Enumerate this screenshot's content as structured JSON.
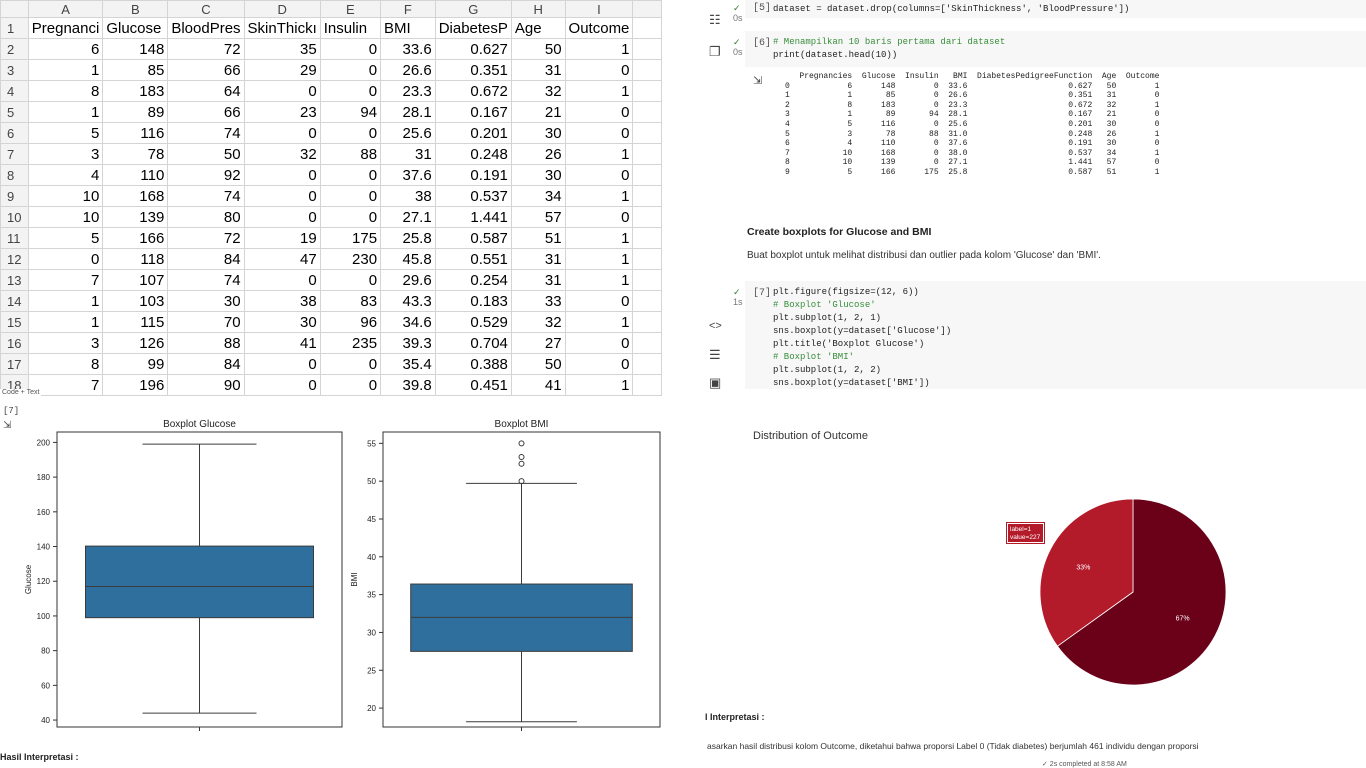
{
  "spreadsheet": {
    "col_letters": [
      "A",
      "B",
      "C",
      "D",
      "E",
      "F",
      "G",
      "H",
      "I"
    ],
    "col_headers": [
      "Pregnanci",
      "Glucose",
      "BloodPres",
      "SkinThickı",
      "Insulin",
      "BMI",
      "DiabetesP",
      "Age",
      "Outcome"
    ],
    "rows": [
      {
        "n": "2",
        "v": [
          "6",
          "148",
          "72",
          "35",
          "0",
          "33.6",
          "0.627",
          "50",
          "1"
        ]
      },
      {
        "n": "3",
        "v": [
          "1",
          "85",
          "66",
          "29",
          "0",
          "26.6",
          "0.351",
          "31",
          "0"
        ]
      },
      {
        "n": "4",
        "v": [
          "8",
          "183",
          "64",
          "0",
          "0",
          "23.3",
          "0.672",
          "32",
          "1"
        ]
      },
      {
        "n": "5",
        "v": [
          "1",
          "89",
          "66",
          "23",
          "94",
          "28.1",
          "0.167",
          "21",
          "0"
        ]
      },
      {
        "n": "6",
        "v": [
          "5",
          "116",
          "74",
          "0",
          "0",
          "25.6",
          "0.201",
          "30",
          "0"
        ]
      },
      {
        "n": "7",
        "v": [
          "3",
          "78",
          "50",
          "32",
          "88",
          "31",
          "0.248",
          "26",
          "1"
        ]
      },
      {
        "n": "8",
        "v": [
          "4",
          "110",
          "92",
          "0",
          "0",
          "37.6",
          "0.191",
          "30",
          "0"
        ]
      },
      {
        "n": "9",
        "v": [
          "10",
          "168",
          "74",
          "0",
          "0",
          "38",
          "0.537",
          "34",
          "1"
        ]
      },
      {
        "n": "10",
        "v": [
          "10",
          "139",
          "80",
          "0",
          "0",
          "27.1",
          "1.441",
          "57",
          "0"
        ]
      },
      {
        "n": "11",
        "v": [
          "5",
          "166",
          "72",
          "19",
          "175",
          "25.8",
          "0.587",
          "51",
          "1"
        ]
      },
      {
        "n": "12",
        "v": [
          "0",
          "118",
          "84",
          "47",
          "230",
          "45.8",
          "0.551",
          "31",
          "1"
        ]
      },
      {
        "n": "13",
        "v": [
          "7",
          "107",
          "74",
          "0",
          "0",
          "29.6",
          "0.254",
          "31",
          "1"
        ]
      },
      {
        "n": "14",
        "v": [
          "1",
          "103",
          "30",
          "38",
          "83",
          "43.3",
          "0.183",
          "33",
          "0"
        ]
      },
      {
        "n": "15",
        "v": [
          "1",
          "115",
          "70",
          "30",
          "96",
          "34.6",
          "0.529",
          "32",
          "1"
        ]
      },
      {
        "n": "16",
        "v": [
          "3",
          "126",
          "88",
          "41",
          "235",
          "39.3",
          "0.704",
          "27",
          "0"
        ]
      },
      {
        "n": "17",
        "v": [
          "8",
          "99",
          "84",
          "0",
          "0",
          "35.4",
          "0.388",
          "50",
          "0"
        ]
      },
      {
        "n": "18",
        "v": [
          "7",
          "196",
          "90",
          "0",
          "0",
          "39.8",
          "0.451",
          "41",
          "1"
        ]
      }
    ],
    "overlay_text": "Code  + Text"
  },
  "notebook": {
    "cell5": {
      "num": "[5]",
      "time": "0s",
      "code": "dataset = dataset.drop(columns=['SkinThickness', 'BloodPressure'])"
    },
    "cell6": {
      "num": "[6]",
      "time": "0s",
      "comment": "# Menampilkan 10 baris pertama dari dataset",
      "code2": "print(dataset.head(10))"
    },
    "output6": "   Pregnancies  Glucose  Insulin   BMI  DiabetesPedigreeFunction  Age  Outcome\n0            6      148        0  33.6                     0.627   50        1\n1            1       85        0  26.6                     0.351   31        0\n2            8      183        0  23.3                     0.672   32        1\n3            1       89       94  28.1                     0.167   21        0\n4            5      116        0  25.6                     0.201   30        0\n5            3       78       88  31.0                     0.248   26        1\n6            4      110        0  37.6                     0.191   30        0\n7           10      168        0  38.0                     0.537   34        1\n8           10      139        0  27.1                     1.441   57        0\n9            5      166      175  25.8                     0.587   51        1",
    "md_title": "Create boxplots for Glucose and BMI",
    "md_text": "Buat boxplot untuk melihat distribusi dan outlier pada kolom 'Glucose' dan 'BMI'.",
    "cell7": {
      "num": "[7]",
      "time": "1s",
      "lines": [
        "plt.figure(figsize=(12, 6))",
        "# Boxplot 'Glucose'",
        "plt.subplot(1, 2, 1)",
        "sns.boxplot(y=dataset['Glucose'])",
        "plt.title('Boxplot Glucose')",
        "# Boxplot 'BMI'",
        "plt.subplot(1, 2, 2)",
        "sns.boxplot(y=dataset['BMI'])"
      ]
    },
    "side_icons": [
      "code-icon",
      "list-icon",
      "terminal-icon"
    ]
  },
  "boxplot_panel": {
    "cell_num": "[7]",
    "footer": "Hasil Interpretasi :"
  },
  "chart_data": [
    {
      "type": "boxplot",
      "title": "Boxplot Glucose",
      "ylabel": "Glucose",
      "ylim": [
        36,
        206
      ],
      "yticks": [
        40,
        60,
        80,
        100,
        120,
        140,
        160,
        180,
        200
      ],
      "whisker_low": 44,
      "q1": 99,
      "median": 117,
      "q3": 140.25,
      "whisker_high": 199,
      "outliers": [],
      "color": "#2e6f9e"
    },
    {
      "type": "boxplot",
      "title": "Boxplot BMI",
      "ylabel": "BMI",
      "ylim": [
        17.5,
        56.5
      ],
      "yticks": [
        20,
        25,
        30,
        35,
        40,
        45,
        50,
        55
      ],
      "whisker_low": 18.2,
      "q1": 27.5,
      "median": 32.0,
      "q3": 36.4,
      "whisker_high": 49.7,
      "outliers": [
        50.0,
        52.3,
        53.2,
        55.0
      ],
      "color": "#2e6f9e"
    },
    {
      "type": "pie",
      "title": "Distribution of Outcome",
      "labels": [
        "0",
        "1"
      ],
      "values": [
        500,
        268
      ],
      "percent_labels": [
        "67%",
        "33%"
      ],
      "colors": [
        "#6b0019",
        "#b31b2b"
      ],
      "tooltip_lines": [
        "label=1",
        "value=227"
      ]
    }
  ],
  "pie_panel": {
    "hasil": "l Interpretasi :",
    "interp": "asarkan hasil distribusi kolom Outcome, diketahui bahwa proporsi Label 0 (Tidak diabetes) berjumlah 461 individu dengan proporsi",
    "status": "✓ 2s   completed at 8:58 AM"
  }
}
